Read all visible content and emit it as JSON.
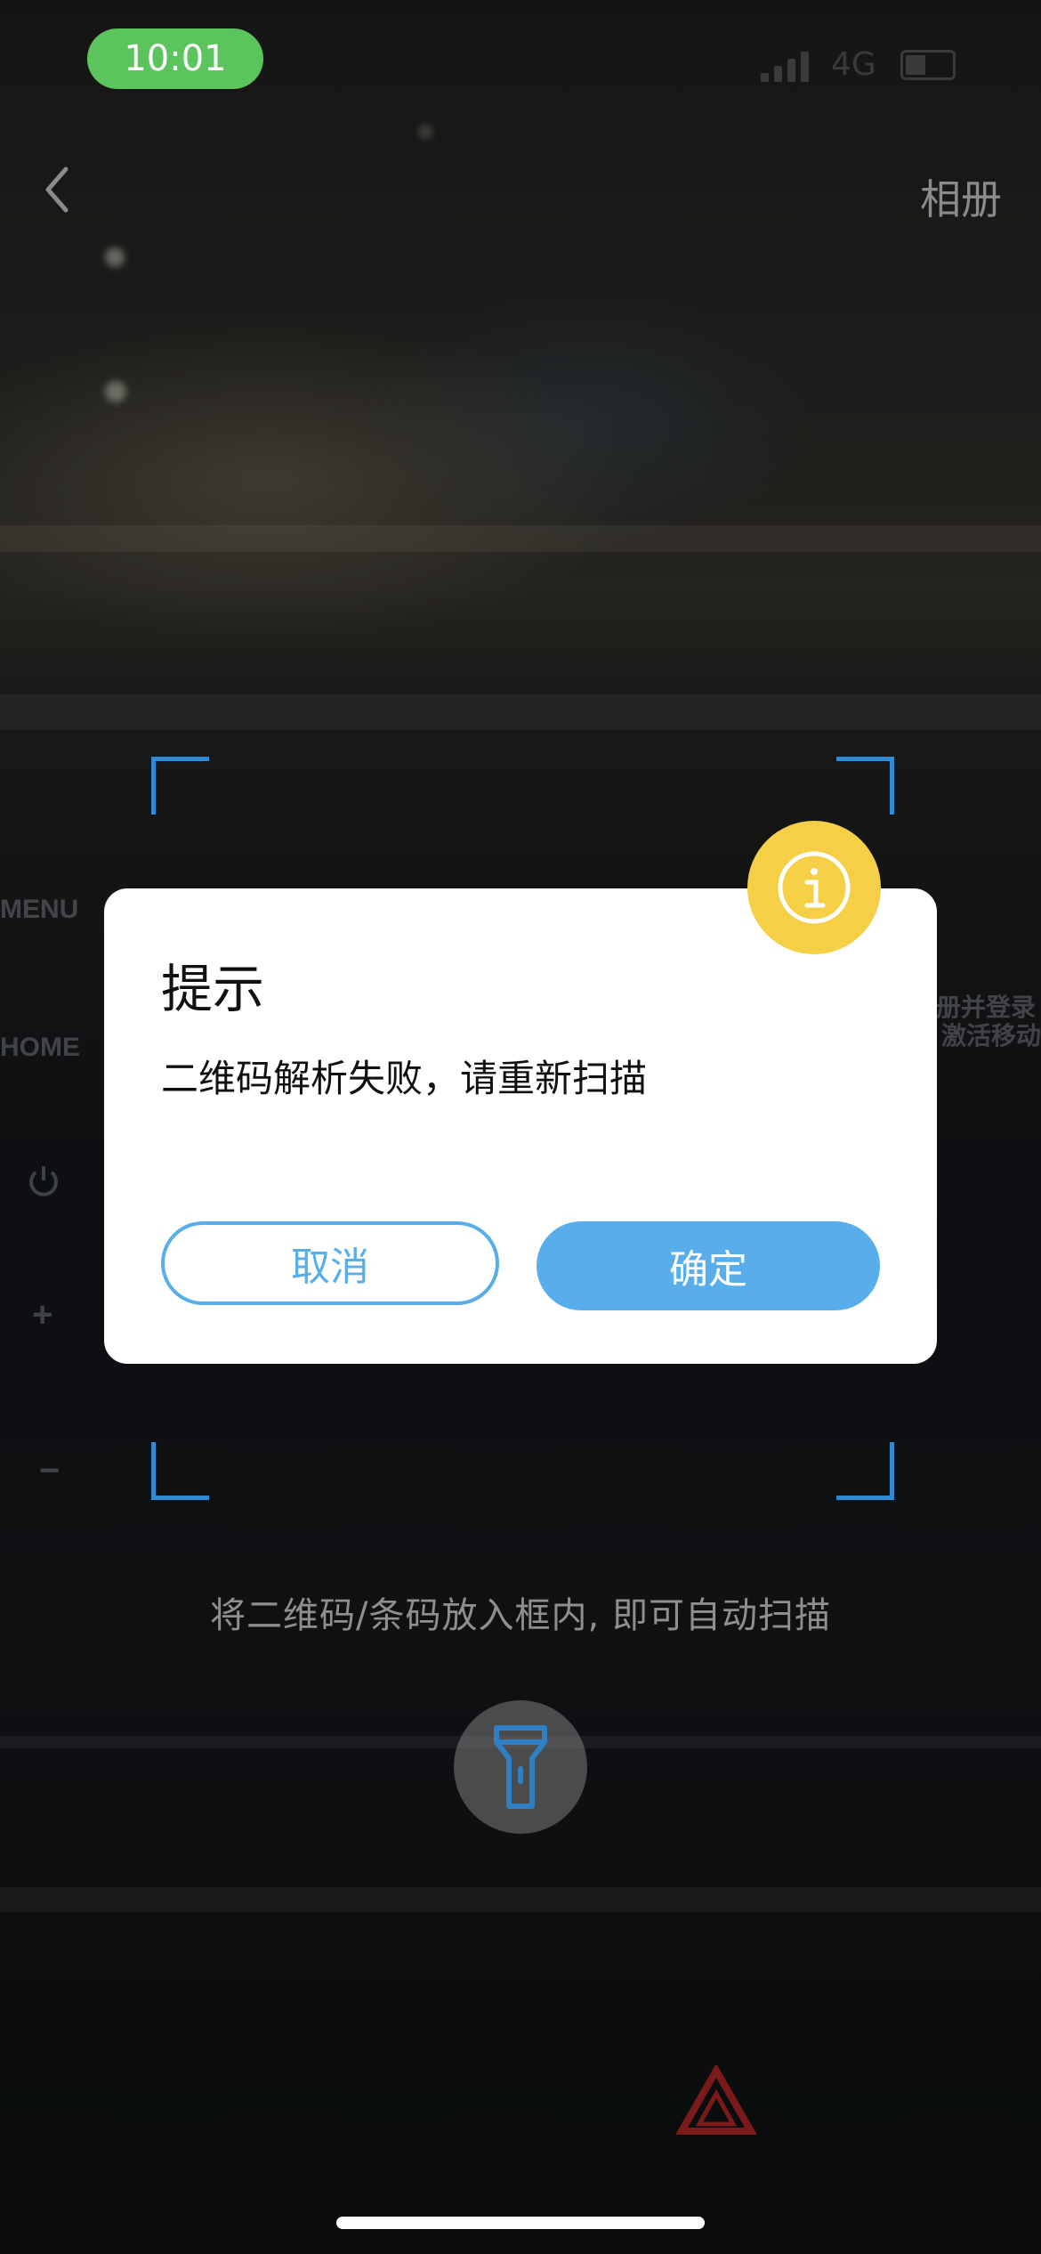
{
  "status_bar": {
    "time": "10:01",
    "network": "4G"
  },
  "nav": {
    "right_label": "相册"
  },
  "background_text": {
    "menu": "MENU",
    "home": "HOME",
    "side_line1": "册并登录",
    "side_line2": "激活移动",
    "plus": "+",
    "minus": "−"
  },
  "scanner": {
    "hint": "将二维码/条码放入框内, 即可自动扫描"
  },
  "dialog": {
    "title": "提示",
    "message": "二维码解析失败，请重新扫描",
    "cancel_label": "取消",
    "confirm_label": "确定",
    "badge_icon": "info-icon"
  },
  "colors": {
    "accent": "#58aeea",
    "badge": "#f5cf45",
    "time_pill": "#5cc45c",
    "frame": "#2e8ad4"
  }
}
